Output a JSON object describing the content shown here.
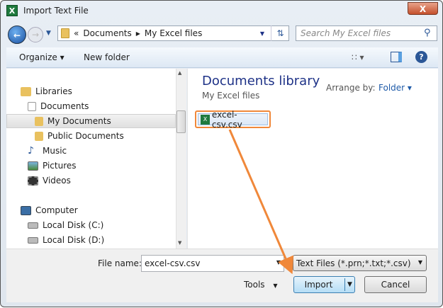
{
  "window": {
    "title": "Import Text File",
    "close": "X",
    "app_icon": "X"
  },
  "address": {
    "prefix": "«",
    "crumbs": [
      "Documents",
      "My Excel files"
    ],
    "search_placeholder": "Search My Excel files"
  },
  "toolbar": {
    "organize": "Organize",
    "new_folder": "New folder"
  },
  "nav": {
    "items": [
      {
        "label": "Libraries",
        "icon": "libraries-icon"
      },
      {
        "label": "Documents",
        "icon": "documents-icon"
      },
      {
        "label": "My Documents",
        "icon": "folder-icon",
        "selected": true
      },
      {
        "label": "Public Documents",
        "icon": "folder-icon"
      },
      {
        "label": "Music",
        "icon": "music-icon"
      },
      {
        "label": "Pictures",
        "icon": "pictures-icon"
      },
      {
        "label": "Videos",
        "icon": "videos-icon"
      },
      {
        "label": "Computer",
        "icon": "computer-icon"
      },
      {
        "label": "Local Disk (C:)",
        "icon": "disk-icon"
      },
      {
        "label": "Local Disk (D:)",
        "icon": "disk-icon"
      }
    ]
  },
  "content": {
    "library_title": "Documents library",
    "library_sub": "My Excel files",
    "arrange_label": "Arrange by:",
    "arrange_value": "Folder",
    "files": [
      {
        "name": "excel-csv.csv"
      }
    ]
  },
  "bottom": {
    "file_name_label": "File name:",
    "file_name_value": "excel-csv.csv",
    "file_type": "Text Files (*.prn;*.txt;*.csv)",
    "tools": "Tools",
    "import": "Import",
    "cancel": "Cancel"
  },
  "colors": {
    "highlight": "#f0883a",
    "accent": "#1e3287"
  }
}
